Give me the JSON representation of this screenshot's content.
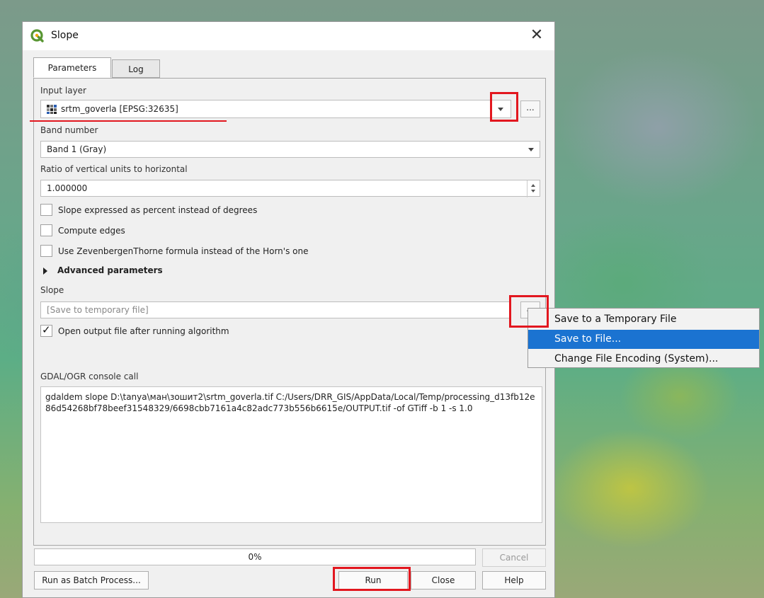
{
  "window": {
    "title": "Slope",
    "close_glyph": "✕",
    "logo_icon": "qgis-logo-icon"
  },
  "tabs": [
    {
      "label": "Parameters",
      "active": true
    },
    {
      "label": "Log",
      "active": false
    }
  ],
  "input_layer": {
    "label": "Input layer",
    "value": "srtm_goverla [EPSG:32635]",
    "browse_label": "..."
  },
  "band": {
    "label": "Band number",
    "value": "Band 1 (Gray)"
  },
  "ratio": {
    "label": "Ratio of vertical units to horizontal",
    "value": "1.000000"
  },
  "options": [
    {
      "label": "Slope expressed as percent instead of degrees",
      "checked": false
    },
    {
      "label": "Compute edges",
      "checked": false
    },
    {
      "label": "Use ZevenbergenThorne formula instead of the Horn's one",
      "checked": false
    }
  ],
  "advanced": {
    "label": "Advanced parameters"
  },
  "slope": {
    "label": "Slope",
    "placeholder": "[Save to temporary file]",
    "browse_label": "..."
  },
  "open_output": {
    "label": "Open output file after running algorithm",
    "checked": true,
    "check_glyph": "✓"
  },
  "console": {
    "label": "GDAL/OGR console call",
    "text": "gdaldem slope D:\\tanya\\ман\\зошит2\\srtm_goverla.tif C:/Users/DRR_GIS/AppData/Local/Temp/processing_d13fb12e86d54268bf78beef31548329/6698cbb7161a4c82adc773b556b6615e/OUTPUT.tif -of GTiff -b 1 -s 1.0"
  },
  "progress": {
    "text": "0%",
    "value": 0
  },
  "buttons": {
    "cancel": "Cancel",
    "batch": "Run as Batch Process...",
    "run": "Run",
    "close": "Close",
    "help": "Help"
  },
  "context_menu": [
    {
      "label": "Save to a Temporary File",
      "highlighted": false
    },
    {
      "label": "Save to File...",
      "highlighted": true
    },
    {
      "label": "Change File Encoding (System)...",
      "highlighted": false
    }
  ],
  "colors": {
    "highlight": "#1b73d1",
    "annotation_red": "#e2171f",
    "qgis_green": "#589632"
  }
}
